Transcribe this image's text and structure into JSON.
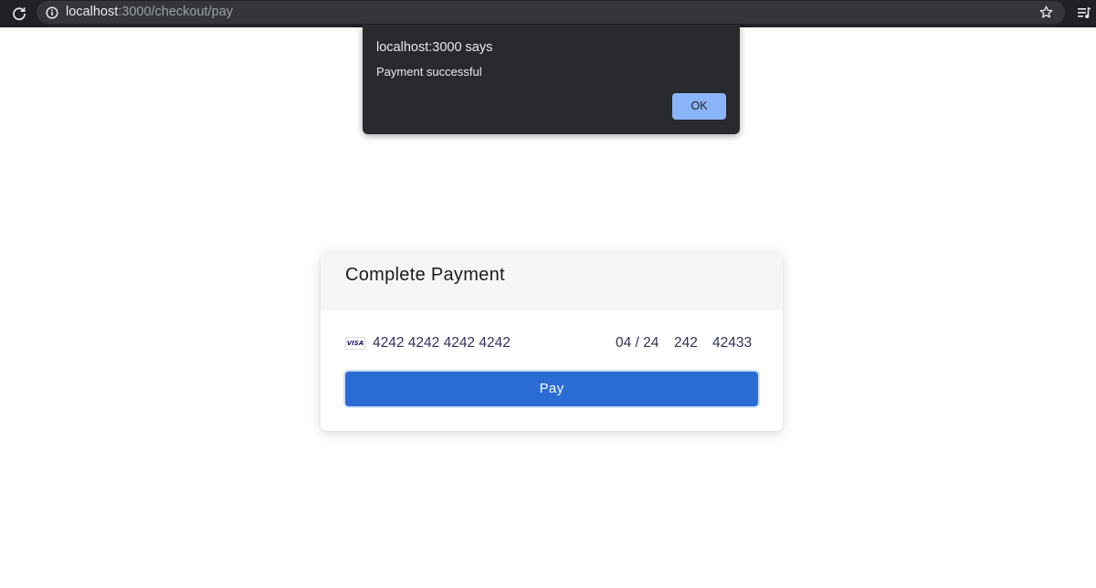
{
  "browser": {
    "url_host": "localhost",
    "url_path": ":3000/checkout/pay",
    "icons": {
      "reload": "reload-icon",
      "site_info": "info-icon",
      "bookmark": "star-icon",
      "reading_list": "reading-list-icon"
    }
  },
  "alert": {
    "title": "localhost:3000 says",
    "message": "Payment successful",
    "ok_label": "OK"
  },
  "payment": {
    "title": "Complete Payment",
    "card_brand_label": "VISA",
    "card_number": "4242 4242 4242 4242",
    "expiry": "04 / 24",
    "cvc": "242",
    "zip": "42433",
    "pay_label": "Pay"
  },
  "colors": {
    "browser_bar": "#202124",
    "dialog_background": "#292a2d",
    "dialog_button": "#8ab4f8",
    "pay_button": "#2a6cd4",
    "card_header": "#f4f5f4"
  }
}
